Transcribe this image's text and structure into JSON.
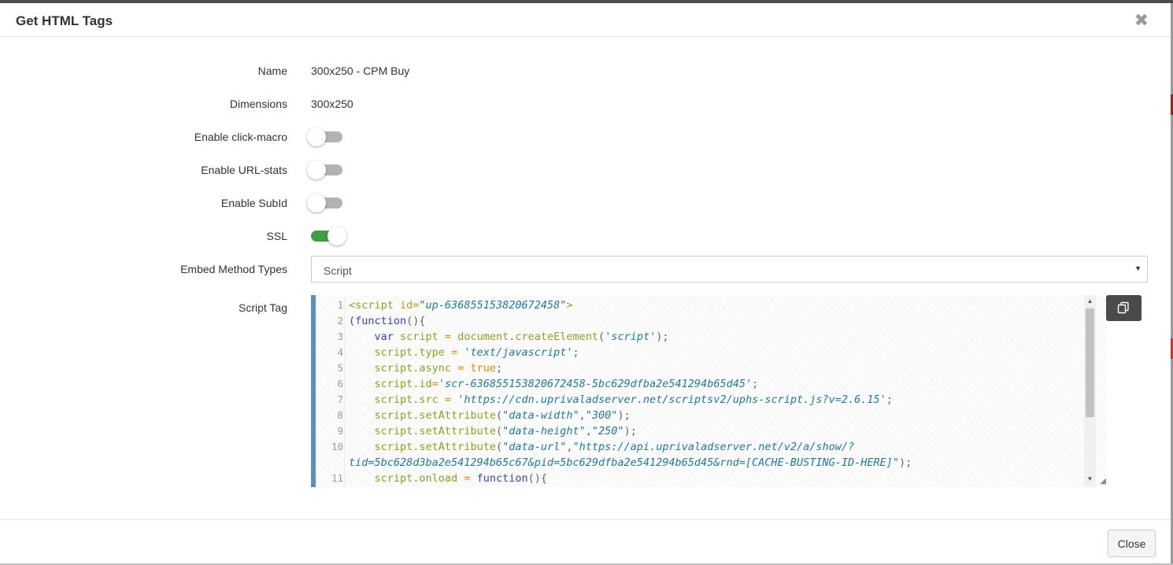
{
  "dialog": {
    "title": "Get HTML Tags",
    "close_glyph": "✖"
  },
  "fields": {
    "name": {
      "label": "Name",
      "value": "300x250 - CPM Buy"
    },
    "dimensions": {
      "label": "Dimensions",
      "value": "300x250"
    },
    "click_macro": {
      "label": "Enable click-macro",
      "enabled": false
    },
    "url_stats": {
      "label": "Enable URL-stats",
      "enabled": false
    },
    "subid": {
      "label": "Enable SubId",
      "enabled": false
    },
    "ssl": {
      "label": "SSL",
      "enabled": true
    },
    "embed_method": {
      "label": "Embed Method Types",
      "value": "Script",
      "arrow": "▼"
    },
    "script_tag": {
      "label": "Script Tag"
    }
  },
  "code": {
    "line_numbers": [
      "1",
      "2",
      "3",
      "4",
      "5",
      "6",
      "7",
      "8",
      "9",
      "10",
      "11"
    ],
    "l1": {
      "open": "<script",
      "attr": " id=",
      "val": "\"up-636855153820672458\"",
      "close": ">"
    },
    "l2": {
      "kw": "(function",
      "rest": "(){"
    },
    "l3": {
      "indent": "    ",
      "kw": "var",
      "name": " script",
      "op": " = ",
      "obj": "document",
      "dot": ".",
      "fn": "createElement",
      "open": "(",
      "str": "'script'",
      "end": ");"
    },
    "l4": {
      "indent": "    ",
      "obj": "script",
      "prop": ".type",
      "op": " = ",
      "str": "'text/javascript'",
      "end": ";"
    },
    "l5": {
      "indent": "    ",
      "obj": "script",
      "prop": ".async",
      "op": " = ",
      "bool": "true",
      "end": ";"
    },
    "l6": {
      "indent": "    ",
      "obj": "script",
      "prop": ".id",
      "op": "=",
      "str": "'scr-636855153820672458-5bc629dfba2e541294b65d45'",
      "end": ";"
    },
    "l7": {
      "indent": "    ",
      "obj": "script",
      "prop": ".src",
      "op": " = ",
      "str": "'https://cdn.uprivaladserver.net/scriptsv2/uphs-script.js?v=2.6.15'",
      "end": ";"
    },
    "l8": {
      "indent": "    ",
      "obj": "script",
      "prop": ".setAttribute",
      "open": "(",
      "s1": "\"data-width\"",
      "comma": ",",
      "s2": "\"300\"",
      "end": ");"
    },
    "l9": {
      "indent": "    ",
      "obj": "script",
      "prop": ".setAttribute",
      "open": "(",
      "s1": "\"data-height\"",
      "comma": ",",
      "s2": "\"250\"",
      "end": ");"
    },
    "l10": {
      "indent": "    ",
      "obj": "script",
      "prop": ".setAttribute",
      "open": "(",
      "s1": "\"data-url\"",
      "comma": ",",
      "s2a": "\"https://api.uprivaladserver.net/v2/a/show/?",
      "s2b": "tid=5bc628d3ba2e541294b65c67&pid=5bc629dfba2e541294b65d45&rnd=[CACHE-BUSTING-ID-HERE]\"",
      "end": ");"
    },
    "l11": {
      "indent": "    ",
      "obj": "script",
      "prop": ".onload",
      "op": " = ",
      "kw": "function",
      "end": "(){"
    }
  },
  "footer": {
    "close_label": "Close"
  },
  "colors": {
    "accent": "#5b8ec4",
    "toggle_on": "#3f9e3f",
    "copy_button": "#4a4a4a"
  },
  "icons": {
    "copy": "copy-icon"
  }
}
